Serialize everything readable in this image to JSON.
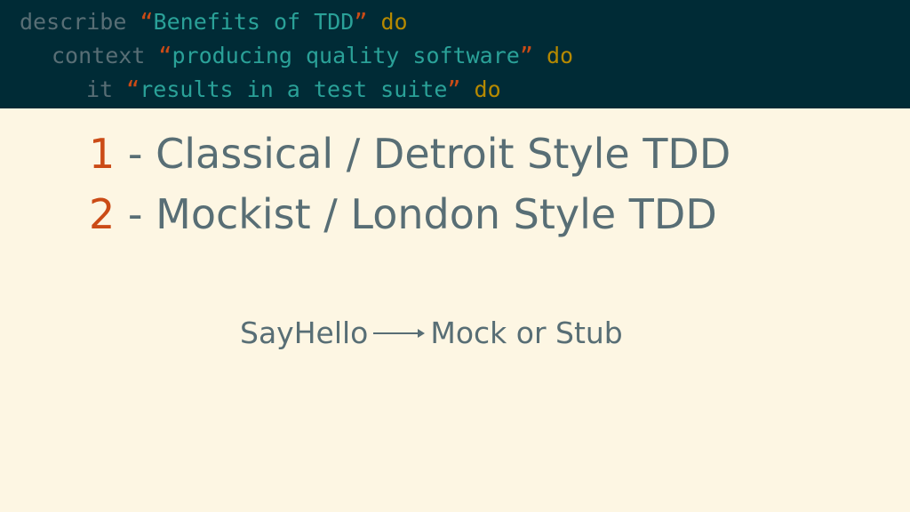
{
  "code": {
    "line1": {
      "keyword": "describe",
      "open_quote": "“",
      "text": "Benefits of TDD",
      "close_quote": "”",
      "do": "do"
    },
    "line2": {
      "keyword": "context",
      "open_quote": "“",
      "text": "producing quality software",
      "close_quote": "”",
      "do": "do"
    },
    "line3": {
      "keyword": "it",
      "open_quote": "“",
      "text": "results in a test suite",
      "close_quote": "”",
      "do": "do"
    }
  },
  "items": [
    {
      "number": "1",
      "text": " - Classical / Detroit Style TDD"
    },
    {
      "number": "2",
      "text": " - Mockist / London Style TDD"
    }
  ],
  "diagram": {
    "from": "SayHello",
    "to": "Mock or Stub"
  },
  "colors": {
    "background": "#fdf6e3",
    "header": "#002b36",
    "accent": "#cb4b16",
    "string": "#2aa198",
    "keyword_do": "#b58900",
    "text": "#586e75"
  }
}
